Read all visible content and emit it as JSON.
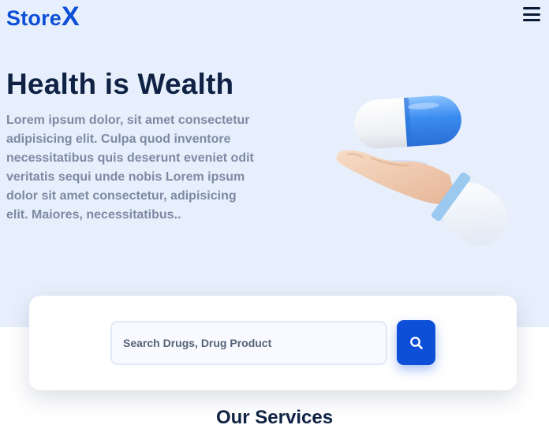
{
  "brand": {
    "name": "Store",
    "accent_letter": "X",
    "color": "#0d4fd6"
  },
  "header": {
    "menu_icon": "hamburger-menu-icon"
  },
  "hero": {
    "title": "Health is Wealth",
    "text": "Lorem ipsum dolor, sit amet consectetur adipisicing elit. Culpa quod inventore necessitatibus quis deserunt eveniet odit veritatis sequi unde nobis Lorem ipsum dolor sit amet consectetur, adipisicing elit. Maiores, necessitatibus..",
    "background": "#e8effc",
    "illustration": "hand-holding-pill-icon"
  },
  "search": {
    "placeholder": "Search Drugs, Drug Product",
    "value": "",
    "button_icon": "search-icon",
    "button_color": "#0d4fd6"
  },
  "services": {
    "title": "Our Services"
  }
}
